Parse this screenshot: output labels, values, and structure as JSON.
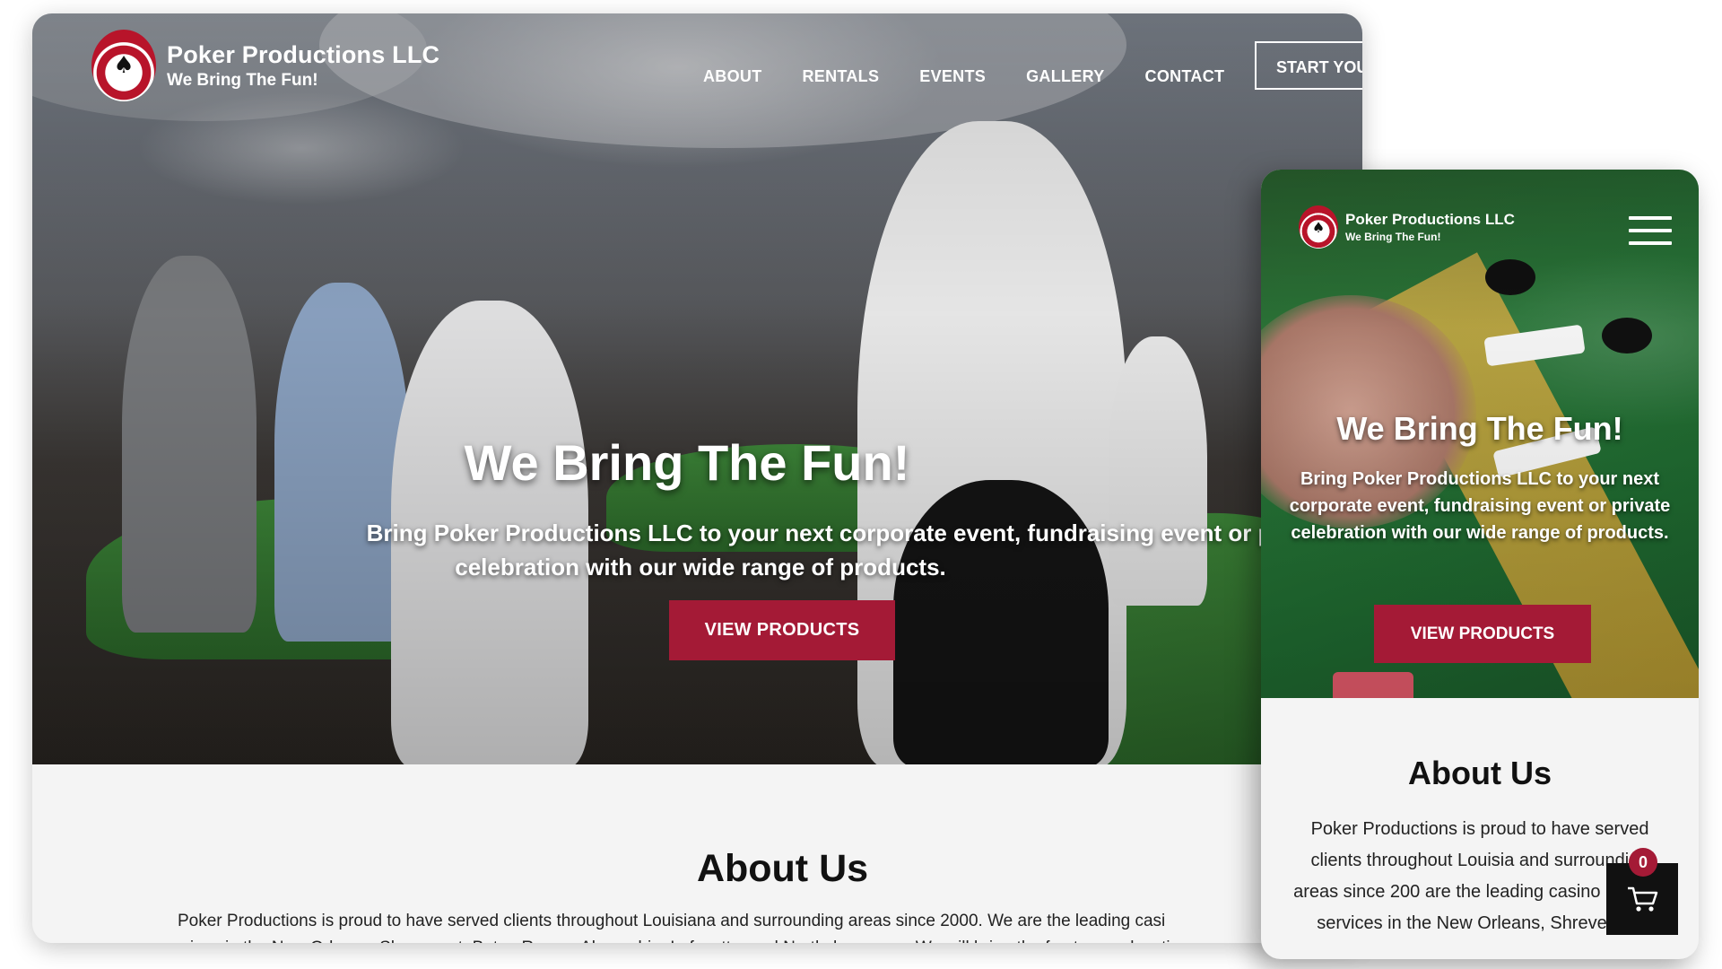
{
  "brand": {
    "name": "Poker Productions LLC",
    "tagline": "We Bring The Fun!"
  },
  "nav": {
    "items": [
      "ABOUT",
      "RENTALS",
      "EVENTS",
      "GALLERY",
      "CONTACT"
    ],
    "cta_label": "START YOU"
  },
  "hero": {
    "title": "We Bring The Fun!",
    "subtitle_line1": "Bring Poker Productions LLC to your next corporate event, fundraising event or privat",
    "subtitle_line2": "celebration with our wide range of products.",
    "button_label": "VIEW PRODUCTS"
  },
  "about": {
    "title": "About Us",
    "line1": "Poker Productions is proud to have served clients throughout Louisiana and surrounding areas since 2000. We are the leading casi",
    "line2": "services in the New Orleans, Shreveport, Baton Rouge, Alexandria, Lafayette, and Northshore area. We will bring the fun to your locatio"
  },
  "mobile": {
    "brand_name": "Poker Productions LLC",
    "brand_tagline": "We Bring The Fun!",
    "hero_title": "We Bring The Fun!",
    "hero_subtitle": "Bring Poker Productions LLC to your next corporate event, fundraising event or private celebration with our wide range of products.",
    "button_label": "VIEW PRODUCTS",
    "about_title": "About Us",
    "about_text": "Poker Productions is proud to have served clients throughout Louisia and surrounding areas since 200 are the leading casino party re services in the New Orleans, Shreveport,"
  },
  "cart": {
    "count": "0",
    "icon": "cart-icon"
  },
  "colors": {
    "accent": "#a41a36",
    "about_bg": "#f4f4f4"
  }
}
